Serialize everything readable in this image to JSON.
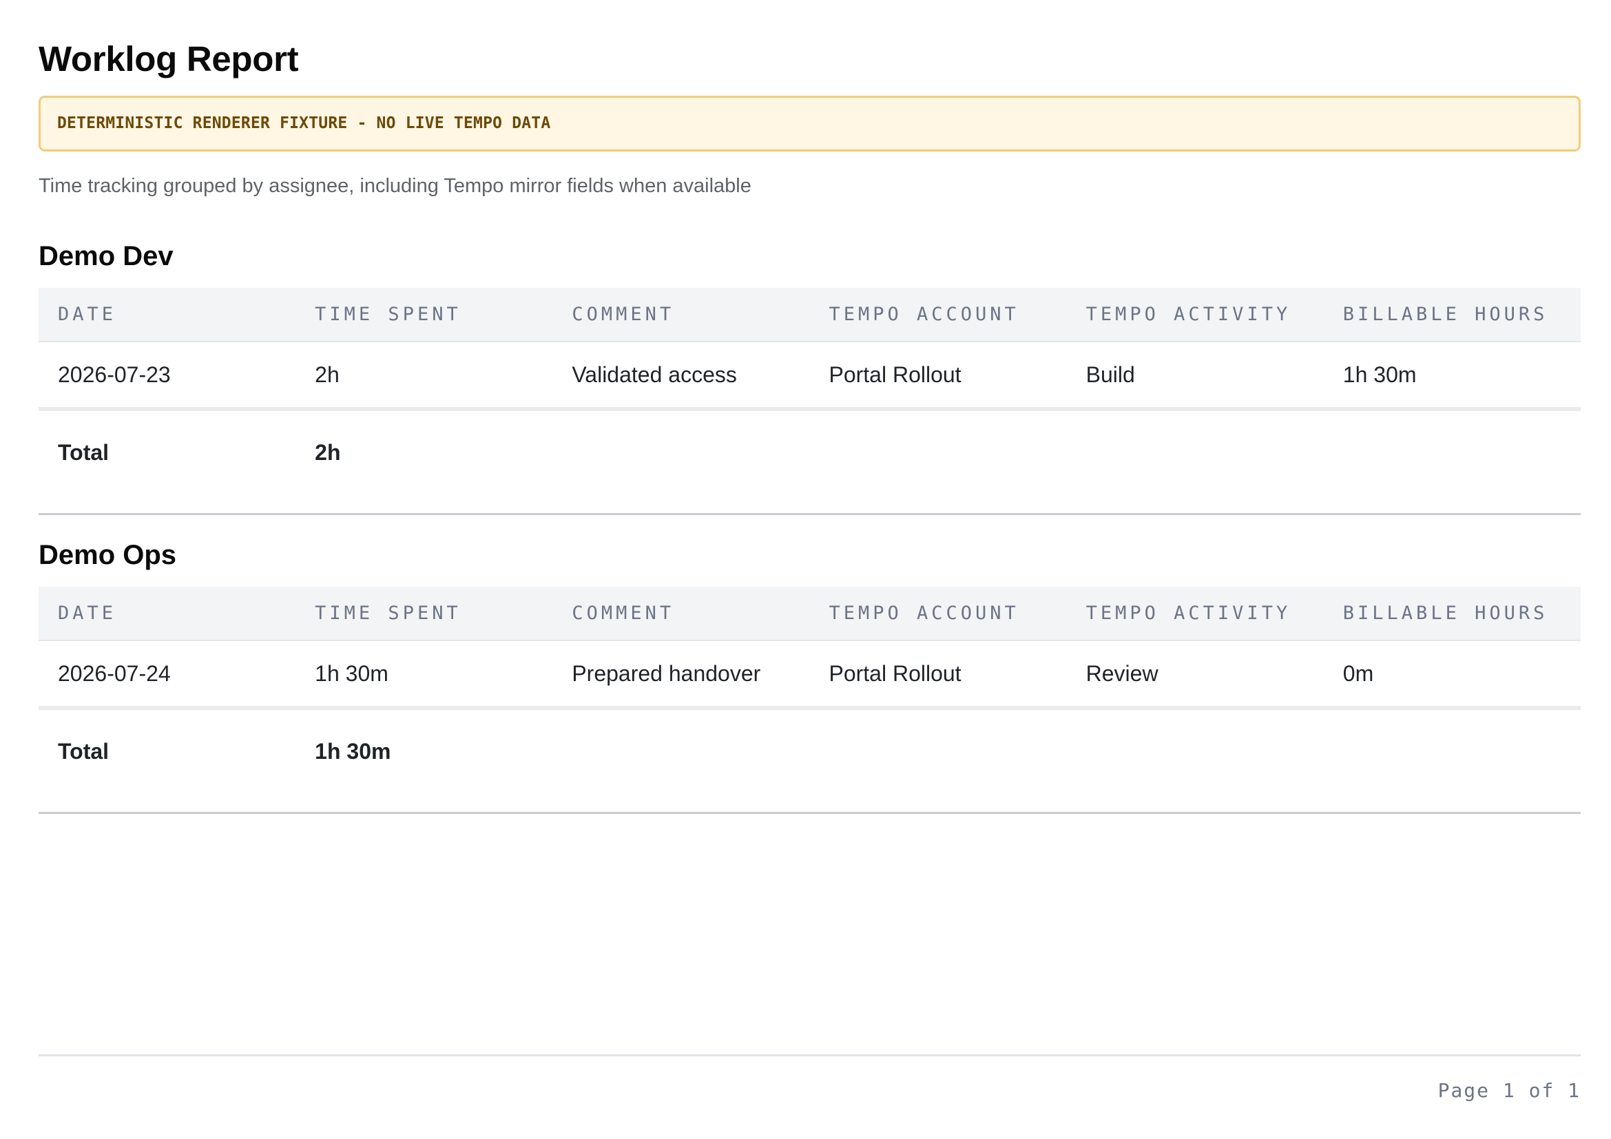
{
  "report": {
    "title": "Worklog Report",
    "banner": "DETERMINISTIC RENDERER FIXTURE - NO LIVE TEMPO DATA",
    "subtitle": "Time tracking grouped by assignee, including Tempo mirror fields when available"
  },
  "columns": [
    "DATE",
    "TIME SPENT",
    "COMMENT",
    "TEMPO ACCOUNT",
    "TEMPO ACTIVITY",
    "BILLABLE HOURS"
  ],
  "groups": [
    {
      "assignee": "Demo Dev",
      "rows": [
        {
          "date": "2026-07-23",
          "time_spent": "2h",
          "comment": "Validated access",
          "tempo_account": "Portal Rollout",
          "tempo_activity": "Build",
          "billable_hours": "1h 30m"
        }
      ],
      "total_label": "Total",
      "total_value": "2h"
    },
    {
      "assignee": "Demo Ops",
      "rows": [
        {
          "date": "2026-07-24",
          "time_spent": "1h 30m",
          "comment": "Prepared handover",
          "tempo_account": "Portal Rollout",
          "tempo_activity": "Review",
          "billable_hours": "0m"
        }
      ],
      "total_label": "Total",
      "total_value": "1h 30m"
    }
  ],
  "footer": {
    "page_label": "Page 1 of 1"
  },
  "colors": {
    "banner_background": "#fff6e3",
    "banner_border": "#f0cd78",
    "banner_text": "#6b4a08",
    "table_header_background": "#f3f4f6",
    "table_header_text": "#6b7485"
  }
}
